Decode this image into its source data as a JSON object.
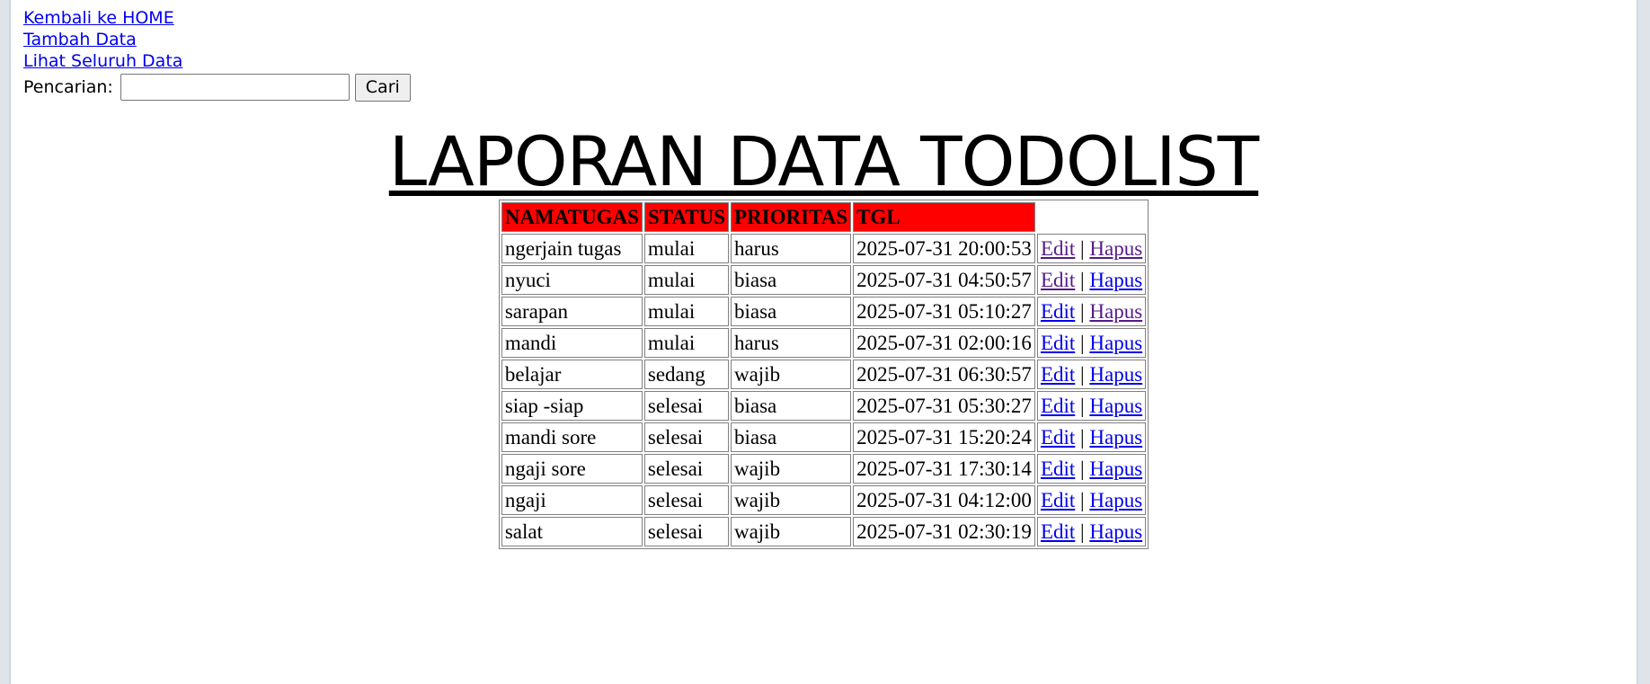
{
  "nav": {
    "home": "Kembali ke HOME",
    "add": "Tambah Data",
    "view_all": "Lihat Seluruh Data"
  },
  "search": {
    "label": "Pencarian:",
    "value": "",
    "button": "Cari"
  },
  "title": "LAPORAN DATA TODOLIST",
  "table": {
    "headers": [
      "NAMATUGAS",
      "STATUS",
      "PRIORITAS",
      "TGL",
      ""
    ],
    "edit_label": "Edit",
    "delete_label": "Hapus",
    "separator": "|",
    "rows": [
      {
        "nama": "ngerjain tugas",
        "status": "mulai",
        "prioritas": "harus",
        "tgl": "2025-07-31 20:00:53"
      },
      {
        "nama": "nyuci",
        "status": "mulai",
        "prioritas": "biasa",
        "tgl": "2025-07-31 04:50:57"
      },
      {
        "nama": "sarapan",
        "status": "mulai",
        "prioritas": "biasa",
        "tgl": "2025-07-31 05:10:27"
      },
      {
        "nama": "mandi",
        "status": "mulai",
        "prioritas": "harus",
        "tgl": "2025-07-31 02:00:16"
      },
      {
        "nama": "belajar",
        "status": "sedang",
        "prioritas": "wajib",
        "tgl": "2025-07-31 06:30:57"
      },
      {
        "nama": "siap -siap",
        "status": "selesai",
        "prioritas": "biasa",
        "tgl": "2025-07-31 05:30:27"
      },
      {
        "nama": "mandi sore",
        "status": "selesai",
        "prioritas": "biasa",
        "tgl": "2025-07-31 15:20:24"
      },
      {
        "nama": "ngaji sore",
        "status": "selesai",
        "prioritas": "wajib",
        "tgl": "2025-07-31 17:30:14"
      },
      {
        "nama": "ngaji",
        "status": "selesai",
        "prioritas": "wajib",
        "tgl": "2025-07-31 04:12:00"
      },
      {
        "nama": "salat",
        "status": "selesai",
        "prioritas": "wajib",
        "tgl": "2025-07-31 02:30:19"
      }
    ]
  },
  "colors": {
    "header_bg": "#ff0000",
    "link": "#0000ee",
    "link_visited": "#551a8b"
  }
}
